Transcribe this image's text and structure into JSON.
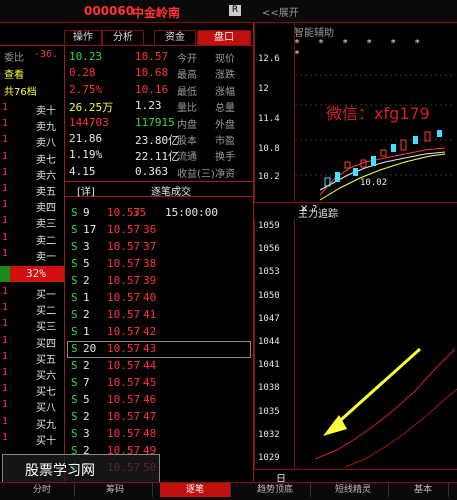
{
  "header": {
    "code": "000060",
    "name": "中金岭南",
    "badge": "R",
    "expand_label": "<<展开"
  },
  "tabs": [
    {
      "label": "盘口",
      "active": true
    },
    {
      "label": "资金",
      "active": false
    },
    {
      "label": "分析",
      "active": false
    },
    {
      "label": "操作",
      "active": false
    }
  ],
  "quote": [
    {
      "label": "今开",
      "value": "10.57",
      "color": "#ff3232"
    },
    {
      "label": "现价",
      "value": "10.23",
      "color": "#33dd33"
    },
    {
      "label": "最高",
      "value": "10.68",
      "color": "#ff3232"
    },
    {
      "label": "涨跌",
      "value": "0.28",
      "color": "#ff3232"
    },
    {
      "label": "最低",
      "value": "10.16",
      "color": "#ff3232"
    },
    {
      "label": "涨幅",
      "value": "2.75%",
      "color": "#ff3232"
    },
    {
      "label": "量比",
      "value": "1.23",
      "color": "#e8e8e8"
    },
    {
      "label": "总量",
      "value": "26.25万",
      "color": "#ffff3b"
    },
    {
      "label": "内盘",
      "value": "117915",
      "color": "#33dd33"
    },
    {
      "label": "外盘",
      "value": "144703",
      "color": "#ff3232"
    },
    {
      "label": "股本",
      "value": "23.80亿",
      "color": "#e8e8e8"
    },
    {
      "label": "市盈",
      "value": "21.86",
      "color": "#e8e8e8"
    },
    {
      "label": "流通",
      "value": "22.11亿",
      "color": "#e8e8e8"
    },
    {
      "label": "换手",
      "value": "1.19%",
      "color": "#e8e8e8"
    },
    {
      "label": "收益(三)",
      "value": "0.363",
      "color": "#e8e8e8"
    },
    {
      "label": "净资",
      "value": "4.15",
      "color": "#e8e8e8"
    }
  ],
  "ticks_header": {
    "title": "逐笔成交",
    "detail": "[详]"
  },
  "ticks": [
    {
      "time": "15:00:00",
      "price": "10.57",
      "vol": "9",
      "side": "S"
    },
    {
      "time": "",
      "price": "10.57",
      "vol": "17",
      "side": "S"
    },
    {
      "time": "",
      "price": "10.57",
      "vol": "3",
      "side": "S"
    },
    {
      "time": "",
      "price": "10.57",
      "vol": "5",
      "side": "S"
    },
    {
      "time": "",
      "price": "10.57",
      "vol": "2",
      "side": "S"
    },
    {
      "time": "",
      "price": "10.57",
      "vol": "1",
      "side": "S"
    },
    {
      "time": "",
      "price": "10.57",
      "vol": "2",
      "side": "S"
    },
    {
      "time": "",
      "price": "10.57",
      "vol": "1",
      "side": "S"
    },
    {
      "time": "",
      "price": "10.57",
      "vol": "20",
      "side": "S"
    },
    {
      "time": "",
      "price": "10.57",
      "vol": "2",
      "side": "S"
    },
    {
      "time": "",
      "price": "10.57",
      "vol": "7",
      "side": "S"
    },
    {
      "time": "",
      "price": "10.57",
      "vol": "5",
      "side": "S"
    },
    {
      "time": "",
      "price": "10.57",
      "vol": "2",
      "side": "S"
    },
    {
      "time": "",
      "price": "10.57",
      "vol": "3",
      "side": "S"
    },
    {
      "time": "",
      "price": "10.57",
      "vol": "2",
      "side": "S"
    },
    {
      "time": "",
      "price": "10.57",
      "vol": "5",
      "side": "S"
    }
  ],
  "tick_ids": [
    "35",
    "36",
    "37",
    "38",
    "39",
    "40",
    "41",
    "42",
    "43",
    "44",
    "45",
    "46",
    "47",
    "48",
    "49",
    "50"
  ],
  "left_column": {
    "head": [
      "委比",
      "-36."
    ],
    "head2": "查看",
    "head3": "共76档",
    "sell_labels": [
      "卖十",
      "卖九",
      "卖八",
      "卖七",
      "卖六",
      "卖五",
      "卖四",
      "卖三",
      "卖二",
      "卖一"
    ],
    "pct": "32%",
    "buy_labels": [
      "买一",
      "买二",
      "买三",
      "买四",
      "买五",
      "买六",
      "买七",
      "买八",
      "买九",
      "买十"
    ]
  },
  "chart": {
    "title": "智能辅助",
    "price_ticks": [
      "12.6",
      "12",
      "11.4",
      "10.8",
      "10.2"
    ],
    "low_label": "10.02",
    "watermark": "微信：xfg179",
    "sub_title": "主力追踪",
    "sub_controls": [
      "✕",
      "?",
      "✕"
    ],
    "sub_ticks": [
      "1059",
      "1056",
      "1053",
      "1050",
      "1047",
      "1044",
      "1041",
      "1038",
      "1035",
      "1032",
      "1029"
    ],
    "day_label": "日"
  },
  "bottom_tabs": [
    {
      "label": "分时",
      "active": false
    },
    {
      "label": "筹码",
      "active": false
    },
    {
      "label": "逐笔",
      "active": true
    },
    {
      "label": "趋势顶底",
      "active": false
    },
    {
      "label": "短线精灵",
      "active": false
    },
    {
      "label": "基本",
      "active": false
    }
  ],
  "watermark_bottom": "股票学习网"
}
